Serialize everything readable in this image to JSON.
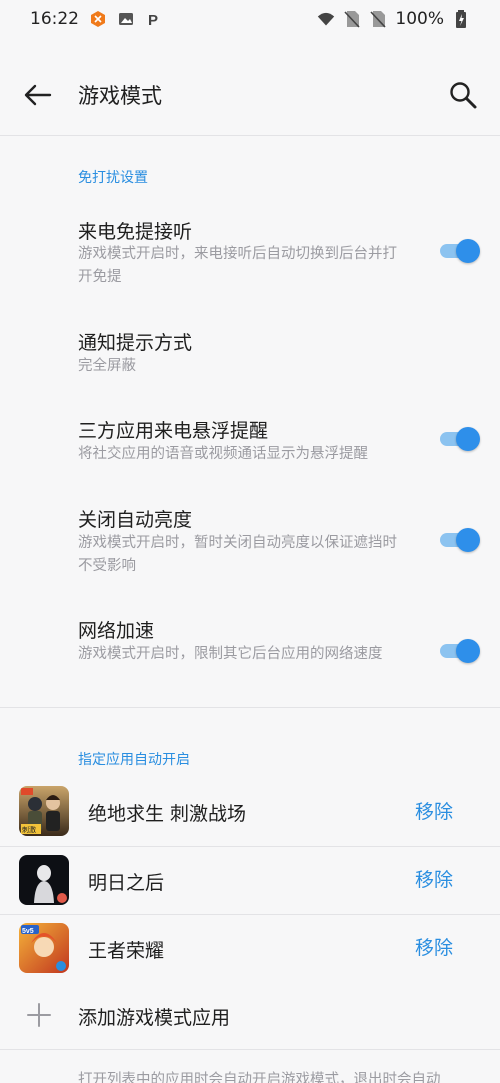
{
  "status_bar": {
    "time": "16:22",
    "battery": "100%"
  },
  "header": {
    "title": "游戏模式"
  },
  "sections": {
    "dnd": {
      "heading": "免打扰设置",
      "items": [
        {
          "title": "来电免提接听",
          "desc": "游戏模式开启时，来电接听后自动切换到后台并打开免提",
          "toggle": true
        },
        {
          "title": "通知提示方式",
          "desc": "完全屏蔽"
        },
        {
          "title": "三方应用来电悬浮提醒",
          "desc": "将社交应用的语音或视频通话显示为悬浮提醒",
          "toggle": true
        },
        {
          "title": "关闭自动亮度",
          "desc": "游戏模式开启时，暂时关闭自动亮度以保证遮挡时不受影响",
          "toggle": true
        },
        {
          "title": "网络加速",
          "desc": "游戏模式开启时，限制其它后台应用的网络速度",
          "toggle": true
        }
      ]
    },
    "apps": {
      "heading": "指定应用自动开启",
      "remove_label": "移除",
      "items": [
        {
          "name": "绝地求生 刺激战场",
          "icon": "pubg-app-icon"
        },
        {
          "name": "明日之后",
          "icon": "lifeafter-app-icon"
        },
        {
          "name": "王者荣耀",
          "icon": "honor-of-kings-app-icon"
        }
      ],
      "add_label": "添加游戏模式应用"
    }
  },
  "footer": {
    "note": "打开列表中的应用时会自动开启游戏模式，退出时会自动"
  },
  "colors": {
    "accent": "#2a8ee0",
    "toggle_on": "#2e8fea",
    "background": "#f7f7f8"
  }
}
